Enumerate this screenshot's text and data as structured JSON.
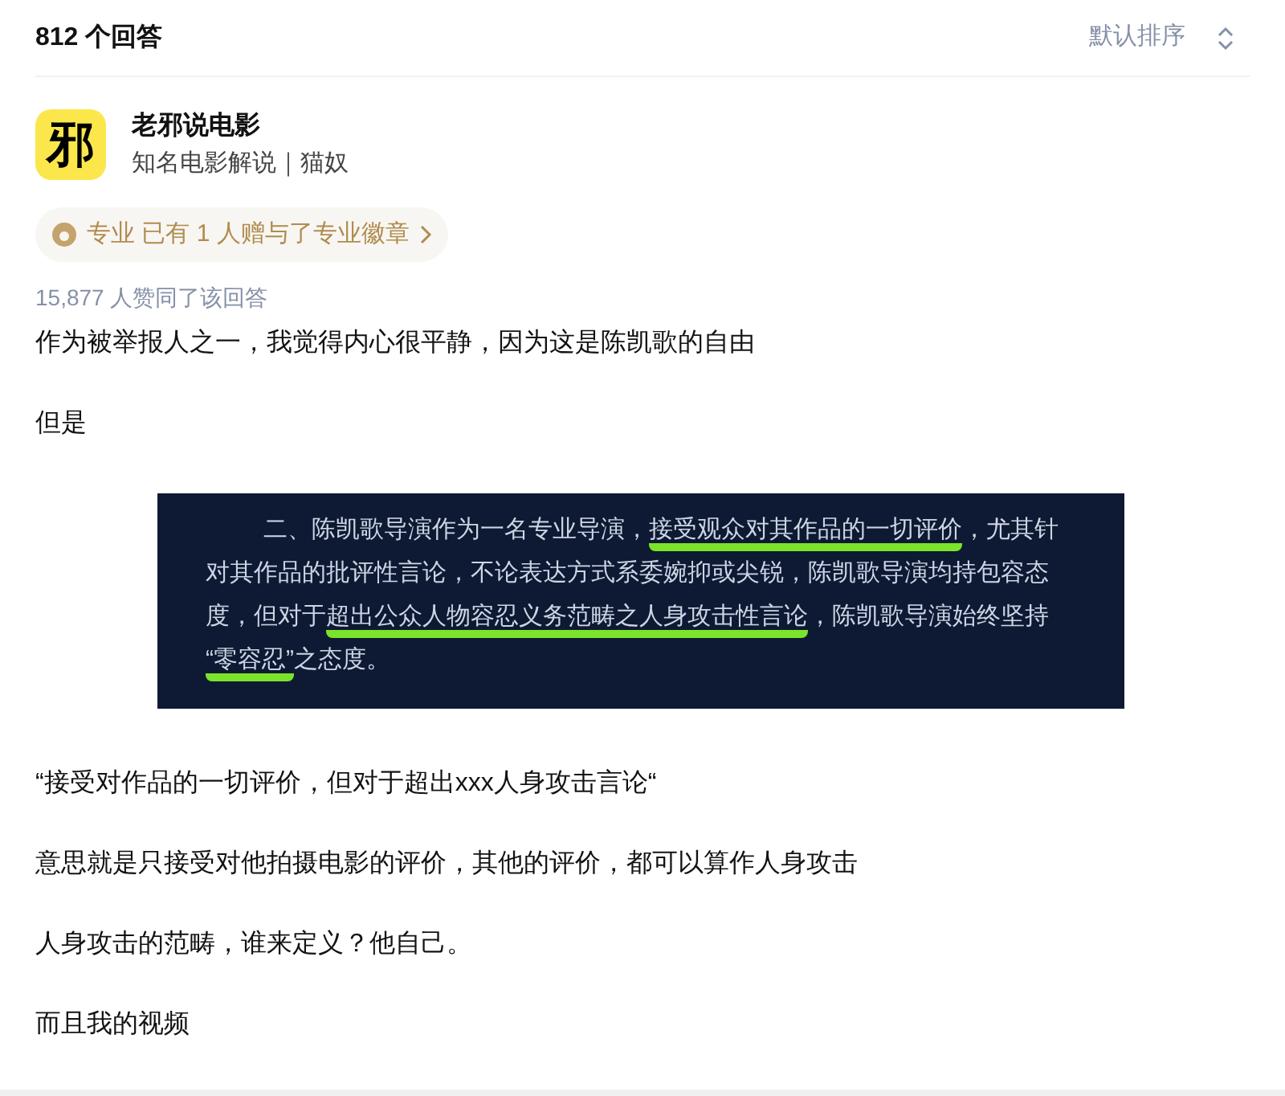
{
  "header": {
    "count": "812 个回答",
    "sort": "默认排序"
  },
  "author": {
    "avatar_text": "邪",
    "name": "老邪说电影",
    "bio": "知名电影解说｜猫奴"
  },
  "badge": {
    "text": "专业 已有 1 人赠与了专业徽章"
  },
  "votes": "15,877 人赞同了该回答",
  "content": [
    {
      "kind": "paragraph",
      "text": "作为被举报人之一，我觉得内心很平静，因为这是陈凯歌的自由"
    },
    {
      "kind": "paragraph",
      "text": "但是"
    },
    {
      "kind": "image",
      "lines": [
        [
          {
            "text": "二、陈凯歌导演作为一名专业导演，",
            "underlined": false
          },
          {
            "text": "接受观众对其作品的一切评价",
            "underlined": true
          },
          {
            "text": "，尤其针",
            "underlined": false
          }
        ],
        [
          {
            "text": "对其作品的批评性言论，不论表达方式系委婉抑或尖锐，陈凯歌导演均持包容态",
            "underlined": false
          }
        ],
        [
          {
            "text": "度，但对于",
            "underlined": false
          },
          {
            "text": "超出公众人物容忍义务范畴之人身攻击性言论",
            "underlined": true
          },
          {
            "text": "，陈凯歌导演始终坚持",
            "underlined": false
          }
        ],
        [
          {
            "text": "“零容忍”",
            "underlined": true
          },
          {
            "text": "之态度。",
            "underlined": false
          }
        ]
      ]
    },
    {
      "kind": "paragraph",
      "text": "“接受对作品的一切评价，但对于超出xxx人身攻击言论“"
    },
    {
      "kind": "paragraph",
      "text": "意思就是只接受对他拍摄电影的评价，其他的评价，都可以算作人身攻击"
    },
    {
      "kind": "paragraph",
      "text": "人身攻击的范畴，谁来定义？他自己。"
    },
    {
      "kind": "paragraph",
      "text": "而且我的视频"
    }
  ]
}
